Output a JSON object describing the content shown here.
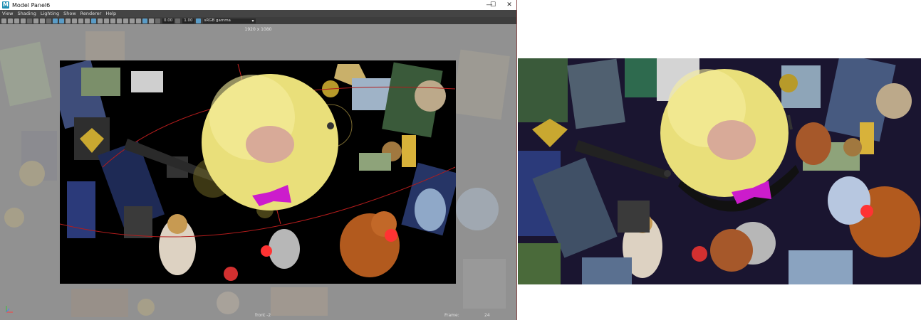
{
  "window": {
    "title": "Model Panel6",
    "app_icon": "maya-icon",
    "controls": {
      "minimize": "—",
      "maximize": "☐",
      "close": "✕"
    }
  },
  "menu": [
    "View",
    "Shading",
    "Lighting",
    "Show",
    "Renderer",
    "Help"
  ],
  "toolbar": {
    "exposure_value": "0.00",
    "gamma_value": "1.00",
    "color_space": "sRGB gamma"
  },
  "viewport": {
    "resolution": "1920 x 1080",
    "camera": "front -2",
    "frame_label": "Frame:",
    "frame_value": "24"
  },
  "colors": {
    "accent": "#5a9cc7",
    "background": "#5c5c5c",
    "sphere": "#e9df7a",
    "bow": "#cc1ccc",
    "spot": "#d8aa98"
  }
}
